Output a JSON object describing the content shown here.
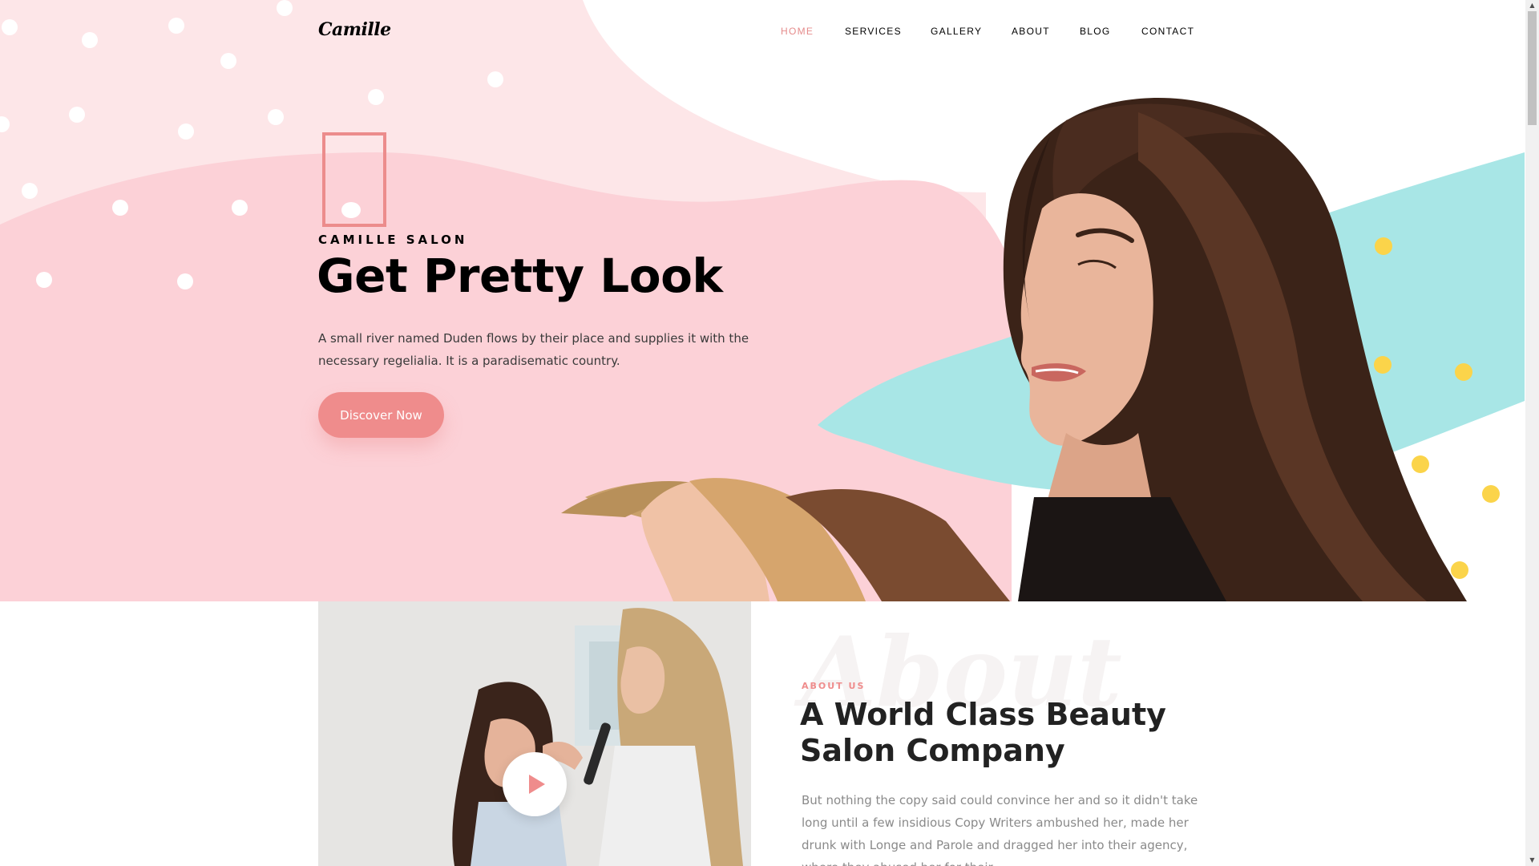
{
  "brand": {
    "logo": "Camille"
  },
  "nav": {
    "items": [
      {
        "label": "HOME",
        "active": true
      },
      {
        "label": "SERVICES",
        "active": false
      },
      {
        "label": "GALLERY",
        "active": false
      },
      {
        "label": "ABOUT",
        "active": false
      },
      {
        "label": "BLOG",
        "active": false
      },
      {
        "label": "CONTACT",
        "active": false
      }
    ]
  },
  "hero": {
    "kicker": "CAMILLE SALON",
    "headline": "Get Pretty Look",
    "lead": "A small river named Duden flows by their place and supplies it with the necessary regelialia. It is a paradisematic country.",
    "cta_label": "Discover Now"
  },
  "about": {
    "watermark": "About",
    "kicker": "ABOUT US",
    "title": "A World Class Beauty Salon Company",
    "text": "But nothing the copy said could convince her and so it didn't take long until a few insidious Copy Writers ambushed her, made her drunk with Longe and Parole and dragged her into their agency, where they abused her for their"
  },
  "colors": {
    "accent": "#ef8c8c",
    "hero_pink": "#fcd1d7",
    "hero_pink_light": "#fde6e8",
    "teal": "#a8e6e6",
    "yellow": "#fbd44a"
  },
  "icons": {
    "play": "play-icon",
    "scroll_up": "scroll-up-arrow-icon",
    "scroll_down": "scroll-down-arrow-icon"
  }
}
